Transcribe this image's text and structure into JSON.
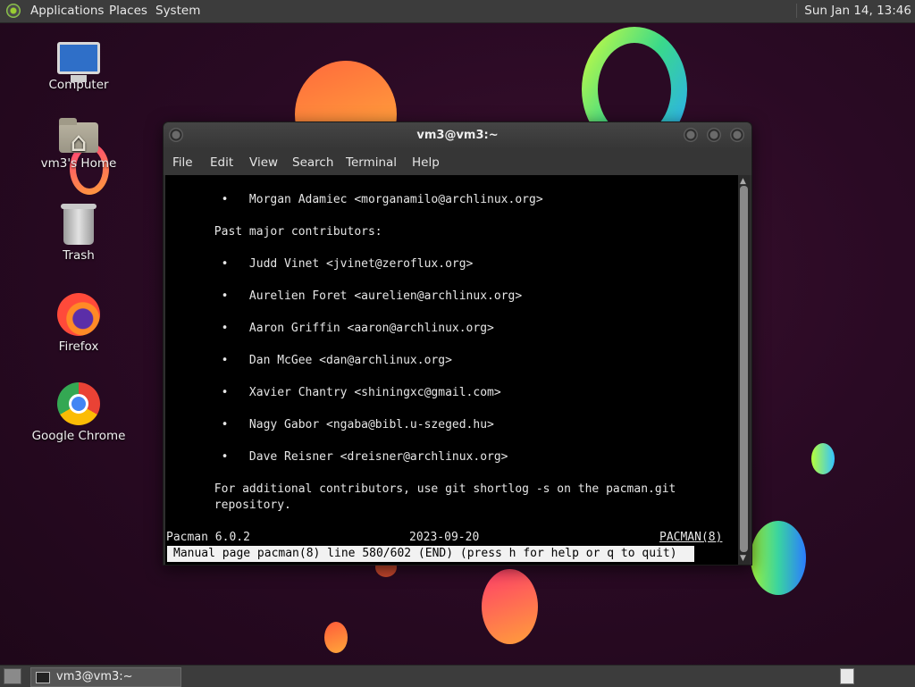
{
  "top_panel": {
    "menus": [
      "Applications",
      "Places",
      "System"
    ],
    "clock": "Sun Jan 14, 13:46"
  },
  "desktop": {
    "icons": [
      {
        "label": "Computer",
        "icon": "computer-icon"
      },
      {
        "label": "vm3's Home",
        "icon": "home-folder-icon"
      },
      {
        "label": "Trash",
        "icon": "trash-icon"
      },
      {
        "label": "Firefox",
        "icon": "firefox-icon"
      },
      {
        "label": "Google Chrome",
        "icon": "chrome-icon"
      }
    ]
  },
  "window": {
    "title": "vm3@vm3:~",
    "menu": [
      "File",
      "Edit",
      "View",
      "Search",
      "Terminal",
      "Help"
    ]
  },
  "terminal": {
    "lines": [
      "        •   Morgan Adamiec <morganamilo@archlinux.org>",
      "",
      "       Past major contributors:",
      "",
      "        •   Judd Vinet <jvinet@zeroflux.org>",
      "",
      "        •   Aurelien Foret <aurelien@archlinux.org>",
      "",
      "        •   Aaron Griffin <aaron@archlinux.org>",
      "",
      "        •   Dan McGee <dan@archlinux.org>",
      "",
      "        •   Xavier Chantry <shiningxc@gmail.com>",
      "",
      "        •   Nagy Gabor <ngaba@bibl.u-szeged.hu>",
      "",
      "        •   Dave Reisner <dreisner@archlinux.org>",
      "",
      "       For additional contributors, use git shortlog -s on the pacman.git",
      "       repository.",
      "",
      ""
    ],
    "footer": {
      "left": "Pacman 6.0.2",
      "center": "2023-09-20",
      "right": "PACMAN(8)"
    },
    "status": "Manual page pacman(8) line 580/602 (END) (press h for help or q to quit)"
  },
  "taskbar": {
    "task_label": "vm3@vm3:~"
  }
}
